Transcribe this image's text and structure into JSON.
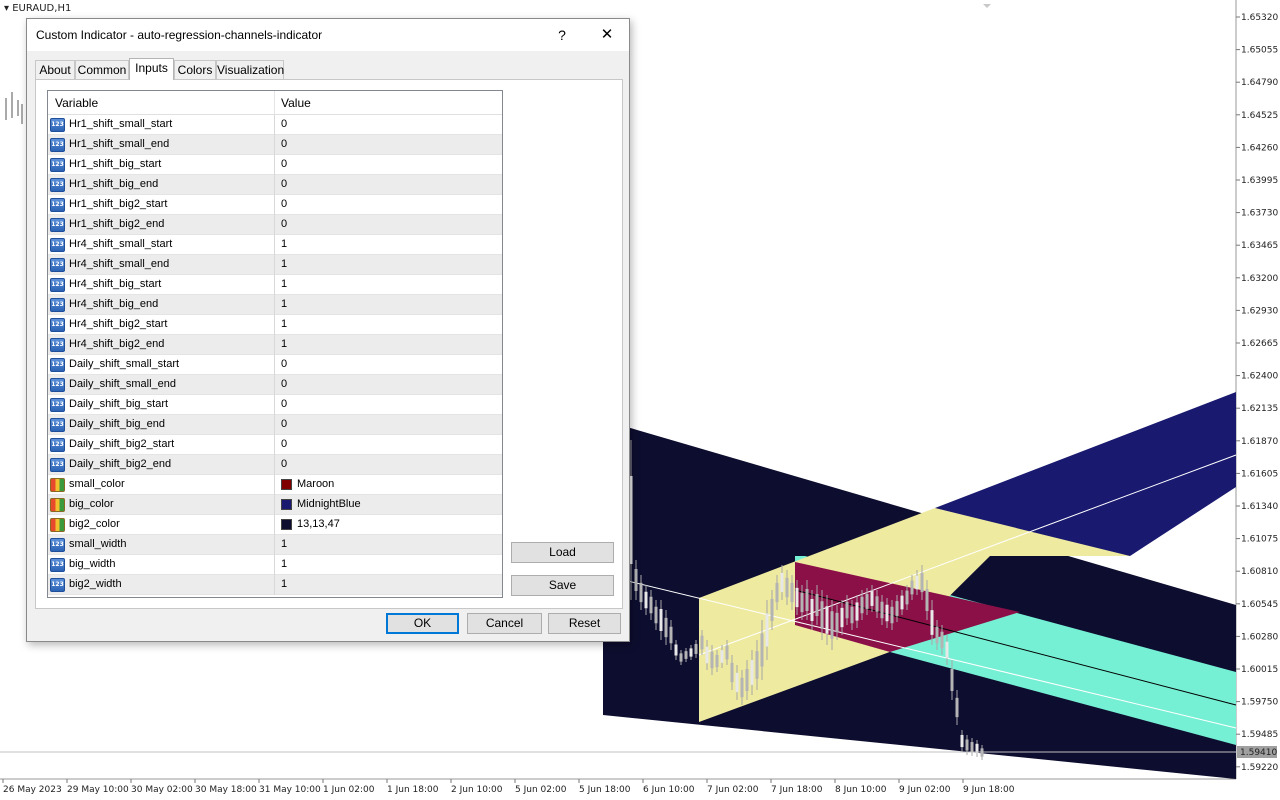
{
  "chart": {
    "symbol": "EURAUD,H1",
    "price_axis": [
      "1.65320",
      "1.65055",
      "1.64790",
      "1.64525",
      "1.64260",
      "1.63995",
      "1.63730",
      "1.63465",
      "1.63200",
      "1.62930",
      "1.62665",
      "1.62400",
      "1.62135",
      "1.61870",
      "1.61605",
      "1.61340",
      "1.61075",
      "1.60810",
      "1.60545",
      "1.60280",
      "1.60015",
      "1.59750",
      "1.59485",
      "1.59220"
    ],
    "current_price": "1.59410",
    "time_axis": [
      "26 May 2023",
      "29 May 10:00",
      "30 May 02:00",
      "30 May 18:00",
      "31 May 10:00",
      "1 Jun 02:00",
      "1 Jun 18:00",
      "2 Jun 10:00",
      "5 Jun 02:00",
      "5 Jun 18:00",
      "6 Jun 10:00",
      "7 Jun 02:00",
      "7 Jun 18:00",
      "8 Jun 10:00",
      "9 Jun 02:00",
      "9 Jun 18:00"
    ],
    "colors": {
      "big2": "#0D0D2F",
      "big": "#191970",
      "small": "#800000",
      "small_overlay": "#8B1048",
      "yellow_channel": "#EEEAA0",
      "aqua_channel": "#76F0D4",
      "price_label_bg": "#A0A0A0"
    }
  },
  "dialog": {
    "title": "Custom Indicator - auto-regression-channels-indicator",
    "help": "?",
    "close": "✕",
    "tabs": [
      "About",
      "Common",
      "Inputs",
      "Colors",
      "Visualization"
    ],
    "active_tab": "Inputs",
    "columns": {
      "variable": "Variable",
      "value": "Value"
    },
    "params": [
      {
        "name": "Hr1_shift_small_start",
        "value": "0"
      },
      {
        "name": "Hr1_shift_small_end",
        "value": "0"
      },
      {
        "name": "Hr1_shift_big_start",
        "value": "0"
      },
      {
        "name": "Hr1_shift_big_end",
        "value": "0"
      },
      {
        "name": "Hr1_shift_big2_start",
        "value": "0"
      },
      {
        "name": "Hr1_shift_big2_end",
        "value": "0"
      },
      {
        "name": "Hr4_shift_small_start",
        "value": "1"
      },
      {
        "name": "Hr4_shift_small_end",
        "value": "1"
      },
      {
        "name": "Hr4_shift_big_start",
        "value": "1"
      },
      {
        "name": "Hr4_shift_big_end",
        "value": "1"
      },
      {
        "name": "Hr4_shift_big2_start",
        "value": "1"
      },
      {
        "name": "Hr4_shift_big2_end",
        "value": "1"
      },
      {
        "name": "Daily_shift_small_start",
        "value": "0"
      },
      {
        "name": "Daily_shift_small_end",
        "value": "0"
      },
      {
        "name": "Daily_shift_big_start",
        "value": "0"
      },
      {
        "name": "Daily_shift_big_end",
        "value": "0"
      },
      {
        "name": "Daily_shift_big2_start",
        "value": "0"
      },
      {
        "name": "Daily_shift_big2_end",
        "value": "0"
      },
      {
        "name": "small_color",
        "value": "Maroon",
        "swatch": "#800000"
      },
      {
        "name": "big_color",
        "value": "MidnightBlue",
        "swatch": "#191970"
      },
      {
        "name": "big2_color",
        "value": "13,13,47",
        "swatch": "#0D0D2F"
      },
      {
        "name": "small_width",
        "value": "1"
      },
      {
        "name": "big_width",
        "value": "1"
      },
      {
        "name": "big2_width",
        "value": "1"
      }
    ],
    "buttons": {
      "load": "Load",
      "save": "Save",
      "ok": "OK",
      "cancel": "Cancel",
      "reset": "Reset"
    }
  }
}
